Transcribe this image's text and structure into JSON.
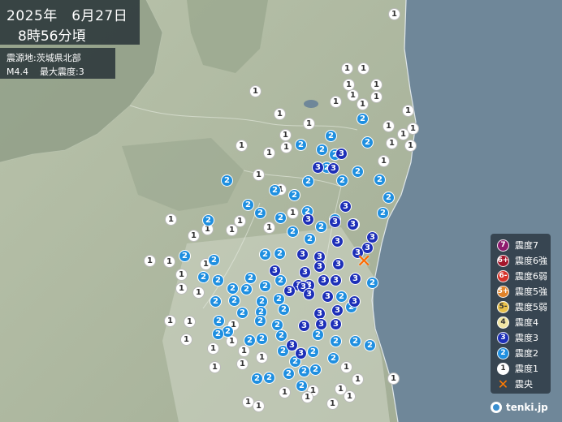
{
  "header": {
    "date": "2025年　6月27日",
    "time": "8時56分頃"
  },
  "info": {
    "epicenter": "震源地:茨城県北部",
    "magnitude": "M4.4",
    "max_intensity": "最大震度:3"
  },
  "legend": {
    "items": [
      {
        "glyph": "7",
        "label": "震度7",
        "color": "#8e1b6e"
      },
      {
        "glyph": "6+",
        "label": "震度6強",
        "color": "#a5162b"
      },
      {
        "glyph": "6-",
        "label": "震度6弱",
        "color": "#d6332a"
      },
      {
        "glyph": "5+",
        "label": "震度5強",
        "color": "#e0832a"
      },
      {
        "glyph": "5-",
        "label": "震度5弱",
        "color": "#e8c14a"
      },
      {
        "glyph": "4",
        "label": "震度4",
        "color": "#f1e6a4"
      },
      {
        "glyph": "3",
        "label": "震度3",
        "color": "#1d2fb8"
      },
      {
        "glyph": "2",
        "label": "震度2",
        "color": "#1f8fe0"
      },
      {
        "glyph": "1",
        "label": "震度1",
        "color": "#ffffff"
      },
      {
        "glyph": "✕",
        "label": "震央",
        "color": "#ff6a00"
      }
    ]
  },
  "brand": "tenki.jp",
  "stations": {
    "int3": [
      [
        420,
        189
      ],
      [
        391,
        206
      ],
      [
        410,
        207
      ],
      [
        425,
        254
      ],
      [
        379,
        270
      ],
      [
        412,
        273
      ],
      [
        434,
        276
      ],
      [
        458,
        292
      ],
      [
        452,
        305
      ],
      [
        415,
        297
      ],
      [
        372,
        313
      ],
      [
        393,
        316
      ],
      [
        416,
        325
      ],
      [
        440,
        311
      ],
      [
        338,
        333
      ],
      [
        375,
        335
      ],
      [
        393,
        328
      ],
      [
        413,
        345
      ],
      [
        437,
        343
      ],
      [
        367,
        351
      ],
      [
        380,
        351
      ],
      [
        398,
        345
      ],
      [
        373,
        353
      ],
      [
        356,
        358
      ],
      [
        380,
        362
      ],
      [
        403,
        365
      ],
      [
        436,
        371
      ],
      [
        415,
        382
      ],
      [
        393,
        386
      ],
      [
        413,
        399
      ],
      [
        395,
        399
      ],
      [
        374,
        401
      ],
      [
        359,
        425
      ],
      [
        370,
        435
      ]
    ],
    "int2": [
      [
        446,
        146
      ],
      [
        407,
        167
      ],
      [
        452,
        175
      ],
      [
        370,
        178
      ],
      [
        396,
        184
      ],
      [
        412,
        190
      ],
      [
        402,
        206
      ],
      [
        440,
        211
      ],
      [
        379,
        223
      ],
      [
        421,
        222
      ],
      [
        279,
        222
      ],
      [
        338,
        234
      ],
      [
        362,
        240
      ],
      [
        305,
        252
      ],
      [
        378,
        260
      ],
      [
        320,
        262
      ],
      [
        256,
        271
      ],
      [
        345,
        268
      ],
      [
        412,
        270
      ],
      [
        471,
        262
      ],
      [
        435,
        276
      ],
      [
        395,
        279
      ],
      [
        360,
        285
      ],
      [
        381,
        294
      ],
      [
        344,
        312
      ],
      [
        326,
        313
      ],
      [
        263,
        320
      ],
      [
        227,
        315
      ],
      [
        250,
        341
      ],
      [
        268,
        345
      ],
      [
        308,
        342
      ],
      [
        326,
        352
      ],
      [
        286,
        355
      ],
      [
        303,
        356
      ],
      [
        345,
        345
      ],
      [
        322,
        371
      ],
      [
        343,
        368
      ],
      [
        458,
        348
      ],
      [
        420,
        365
      ],
      [
        265,
        371
      ],
      [
        288,
        370
      ],
      [
        321,
        384
      ],
      [
        349,
        381
      ],
      [
        432,
        378
      ],
      [
        298,
        385
      ],
      [
        413,
        420
      ],
      [
        437,
        420
      ],
      [
        455,
        425
      ],
      [
        269,
        395
      ],
      [
        280,
        408
      ],
      [
        268,
        411
      ],
      [
        320,
        395
      ],
      [
        341,
        400
      ],
      [
        322,
        417
      ],
      [
        346,
        413
      ],
      [
        307,
        419
      ],
      [
        391,
        412
      ],
      [
        348,
        432
      ],
      [
        385,
        433
      ],
      [
        410,
        441
      ],
      [
        363,
        445
      ],
      [
        374,
        457
      ],
      [
        355,
        460
      ],
      [
        388,
        455
      ],
      [
        331,
        465
      ],
      [
        316,
        466
      ],
      [
        371,
        475
      ],
      [
        467,
        221
      ],
      [
        478,
        243
      ]
    ],
    "int1": [
      [
        485,
        17
      ],
      [
        427,
        84
      ],
      [
        447,
        84
      ],
      [
        463,
        104
      ],
      [
        429,
        104
      ],
      [
        413,
        125
      ],
      [
        446,
        128
      ],
      [
        434,
        117
      ],
      [
        463,
        119
      ],
      [
        314,
        112
      ],
      [
        344,
        140
      ],
      [
        502,
        136
      ],
      [
        478,
        155
      ],
      [
        380,
        152
      ],
      [
        508,
        158
      ],
      [
        496,
        165
      ],
      [
        482,
        176
      ],
      [
        351,
        166
      ],
      [
        331,
        188
      ],
      [
        352,
        181
      ],
      [
        297,
        179
      ],
      [
        472,
        198
      ],
      [
        505,
        179
      ],
      [
        318,
        215
      ],
      [
        345,
        233
      ],
      [
        360,
        262
      ],
      [
        210,
        270
      ],
      [
        238,
        290
      ],
      [
        255,
        282
      ],
      [
        285,
        283
      ],
      [
        295,
        272
      ],
      [
        331,
        280
      ],
      [
        184,
        321
      ],
      [
        208,
        322
      ],
      [
        223,
        338
      ],
      [
        253,
        325
      ],
      [
        223,
        355
      ],
      [
        244,
        360
      ],
      [
        209,
        395
      ],
      [
        233,
        396
      ],
      [
        229,
        418
      ],
      [
        287,
        400
      ],
      [
        285,
        420
      ],
      [
        262,
        429
      ],
      [
        300,
        432
      ],
      [
        298,
        448
      ],
      [
        322,
        440
      ],
      [
        264,
        452
      ],
      [
        484,
        466
      ],
      [
        426,
        452
      ],
      [
        440,
        467
      ],
      [
        419,
        479
      ],
      [
        385,
        481
      ],
      [
        305,
        495
      ],
      [
        318,
        500
      ],
      [
        409,
        497
      ],
      [
        430,
        488
      ],
      [
        378,
        489
      ],
      [
        350,
        483
      ]
    ],
    "epicenter": [
      448,
      323
    ]
  }
}
